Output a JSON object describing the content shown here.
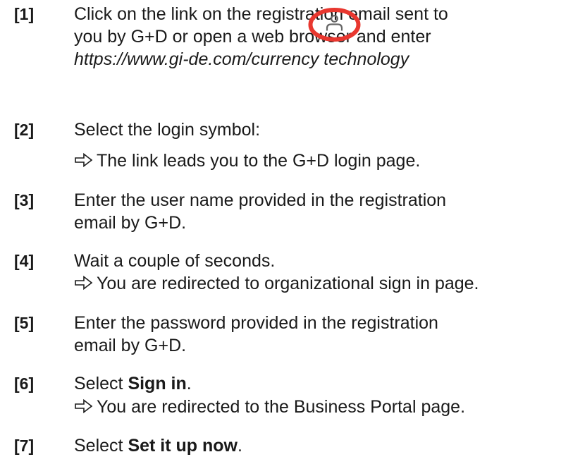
{
  "steps": [
    {
      "num": "[1]",
      "lines": [
        "Click on the link on the registration email sent to",
        "you by G+D or open a web browser and enter",
        "https://www.gi-de.com/currency technology"
      ]
    },
    {
      "num": "[2]",
      "text": "Select the login symbol:",
      "icon": "login-user-icon",
      "result": "The link leads you to the G+D login page."
    },
    {
      "num": "[3]",
      "lines": [
        "Enter the user name provided in the registration",
        "email by G+D."
      ]
    },
    {
      "num": "[4]",
      "text": "Wait a couple of seconds.",
      "result": "You are redirected to organizational sign in page."
    },
    {
      "num": "[5]",
      "lines": [
        "Enter the password provided in the registration",
        "email by G+D."
      ]
    },
    {
      "num": "[6]",
      "prefix": "Select ",
      "bold": "Sign in",
      "suffix": ".",
      "result": "You are redirected to the Business Portal page."
    },
    {
      "num": "[7]",
      "prefix": "Select ",
      "bold": "Set it up now",
      "suffix": "."
    }
  ],
  "colors": {
    "text": "#1a1a1a",
    "icon_ring": "#e8372f",
    "icon_glyph": "#666666"
  }
}
